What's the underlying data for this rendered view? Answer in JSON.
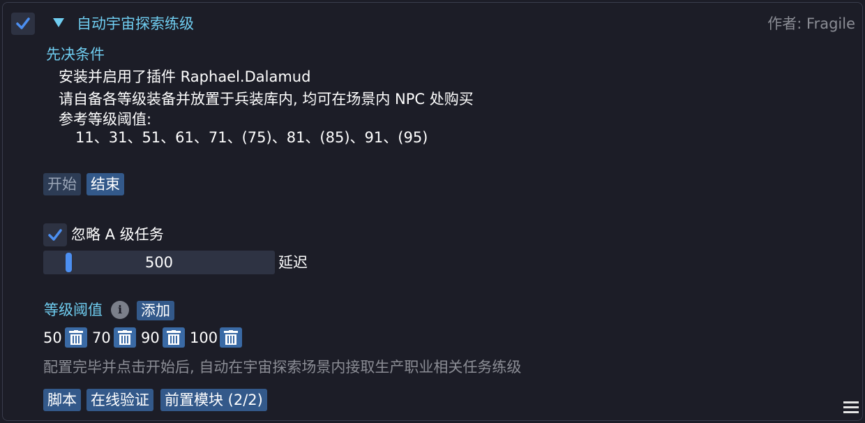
{
  "header": {
    "enabled": true,
    "title": "自动宇宙探索练级",
    "author": "作者: Fragile"
  },
  "prerequisites": {
    "heading": "先决条件",
    "lines": [
      "安装并启用了插件 Raphael.Dalamud",
      "请自备各等级装备并放置于兵装库内, 均可在场景内 NPC 处购买",
      "参考等级阈值:"
    ],
    "levels": "11、31、51、61、71、(75)、81、(85)、91、(95)"
  },
  "controls": {
    "start_label": "开始",
    "stop_label": "结束",
    "ignore_a_label": "忽略 A 级任务",
    "ignore_a_checked": true,
    "delay_value": "500",
    "delay_value_fraction": 0.1,
    "delay_label": "延迟"
  },
  "thresholds": {
    "heading": "等级阈值",
    "add_label": "添加",
    "values": [
      "50",
      "70",
      "90",
      "100"
    ]
  },
  "hint": "配置完毕并点击开始后, 自动在宇宙探索场景内接取生产职业相关任务练级",
  "footer": {
    "script_label": "脚本",
    "verify_label": "在线验证",
    "prereq_label": "前置模块 (2/2)"
  },
  "colors": {
    "accent": "#6fcdf0",
    "button": "#33598a",
    "check": "#4c8ff1",
    "muted": "#8b8d95"
  },
  "icons": [
    "checkmark-icon",
    "collapse-caret-icon",
    "info-icon",
    "trash-icon",
    "hamburger-menu-icon"
  ]
}
